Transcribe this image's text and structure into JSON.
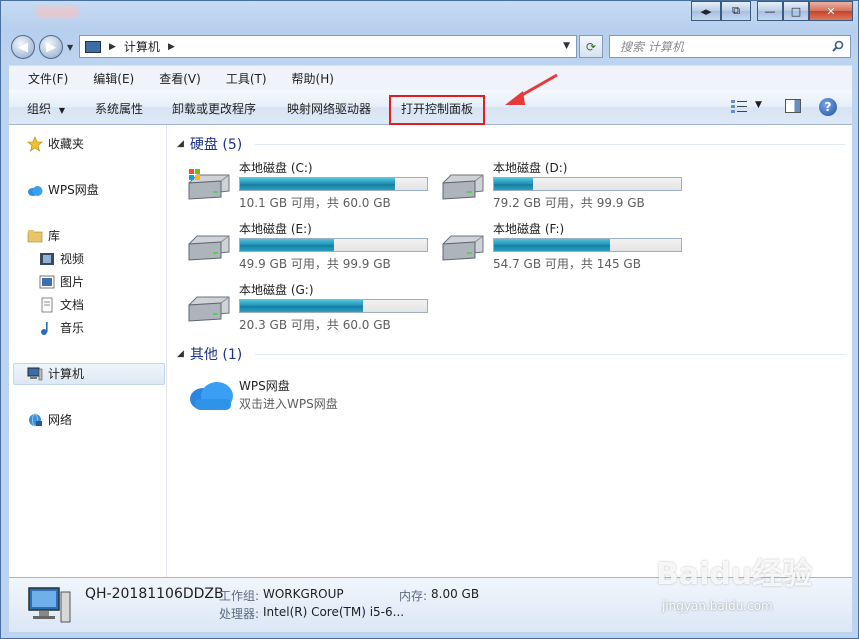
{
  "address": {
    "computer": "计算机"
  },
  "search": {
    "placeholder": "搜索 计算机"
  },
  "menubar": [
    "文件(F)",
    "编辑(E)",
    "查看(V)",
    "工具(T)",
    "帮助(H)"
  ],
  "commands": {
    "organize": "组织",
    "system_properties": "系统属性",
    "uninstall": "卸载或更改程序",
    "map_drive": "映射网络驱动器",
    "control_panel": "打开控制面板"
  },
  "sidebar": {
    "favorites": "收藏夹",
    "wps": "WPS网盘",
    "library": "库",
    "video": "视频",
    "pictures": "图片",
    "documents": "文档",
    "music": "音乐",
    "computer": "计算机",
    "network": "网络"
  },
  "groups": {
    "hard_disks": "硬盘 (5)",
    "others": "其他 (1)"
  },
  "drives": [
    {
      "name": "本地磁盘 (C:)",
      "free": "10.1 GB 可用，共 60.0 GB",
      "used_fraction": 0.83
    },
    {
      "name": "本地磁盘 (D:)",
      "free": "79.2 GB 可用，共 99.9 GB",
      "used_fraction": 0.21
    },
    {
      "name": "本地磁盘 (E:)",
      "free": "49.9 GB 可用，共 99.9 GB",
      "used_fraction": 0.5
    },
    {
      "name": "本地磁盘 (F:)",
      "free": "54.7 GB 可用，共 145 GB",
      "used_fraction": 0.62
    },
    {
      "name": "本地磁盘 (G:)",
      "free": "20.3 GB 可用，共 60.0 GB",
      "used_fraction": 0.66
    }
  ],
  "other_item": {
    "name": "WPS网盘",
    "description": "双击进入WPS网盘"
  },
  "details": {
    "pc_name": "QH-20181106DDZB",
    "workgroup_label": "工作组:",
    "workgroup": "WORKGROUP",
    "memory_label": "内存:",
    "memory": "8.00 GB",
    "cpu_label": "处理器:",
    "cpu": "Intel(R) Core(TM) i5-6..."
  },
  "watermark": {
    "brand": "Baidu经验",
    "url": "jingyan.baidu.com"
  },
  "colors": {
    "highlight_box": "#e02020",
    "drive_fill": "#1e8fb3",
    "group_header": "#1e3287"
  }
}
